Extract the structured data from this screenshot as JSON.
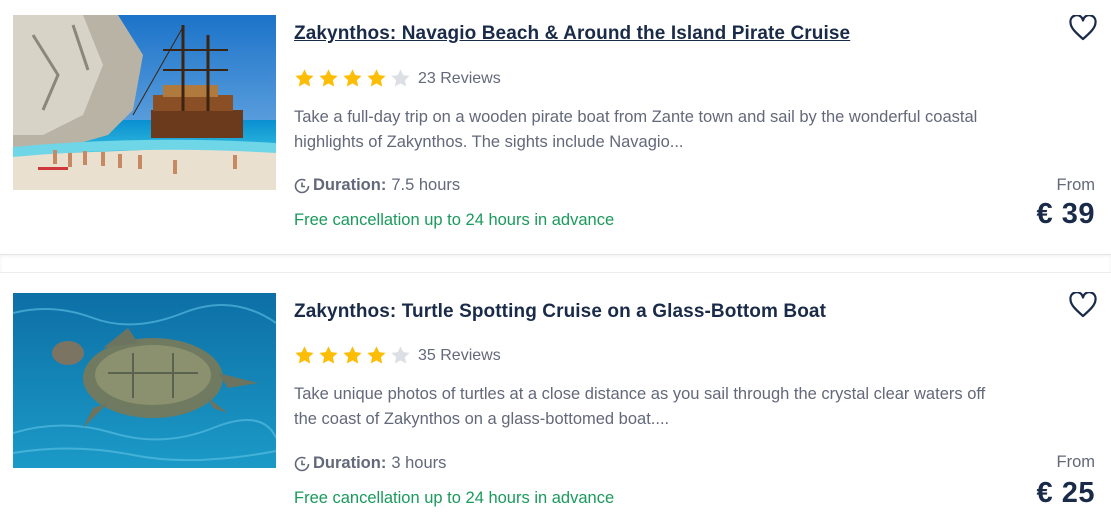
{
  "colors": {
    "title": "#1a2b49",
    "text_muted": "#63687a",
    "cancellation_green": "#1a9a5c",
    "star_filled": "#fdbd04",
    "star_empty": "#dcdfe4"
  },
  "cards": [
    {
      "title": "Zakynthos: Navagio Beach & Around the Island Pirate Cruise",
      "rating": 4,
      "reviews": "23 Reviews",
      "description_line1": "Take a full-day trip on a wooden pirate boat from Zante town and sail by the wonderful coastal",
      "description_line2": "highlights of Zakynthos. The sights include Navagio...",
      "duration_label": "Duration:",
      "duration_value": "7.5 hours",
      "cancellation": "Free cancellation up to 24 hours in advance",
      "from_label": "From",
      "price": "€ 39",
      "image_icon": "pirate-ship-beach-photo"
    },
    {
      "title": "Zakynthos: Turtle Spotting Cruise on a Glass-Bottom Boat",
      "rating": 4,
      "reviews": "35 Reviews",
      "description_line1": "Take unique photos of turtles at a close distance as you sail through the crystal clear waters off",
      "description_line2": "the coast of Zakynthos on a glass-bottomed boat....",
      "duration_label": "Duration:",
      "duration_value": "3 hours",
      "cancellation": "Free cancellation up to 24 hours in advance",
      "from_label": "From",
      "price": "€ 25",
      "image_icon": "sea-turtle-photo"
    }
  ]
}
